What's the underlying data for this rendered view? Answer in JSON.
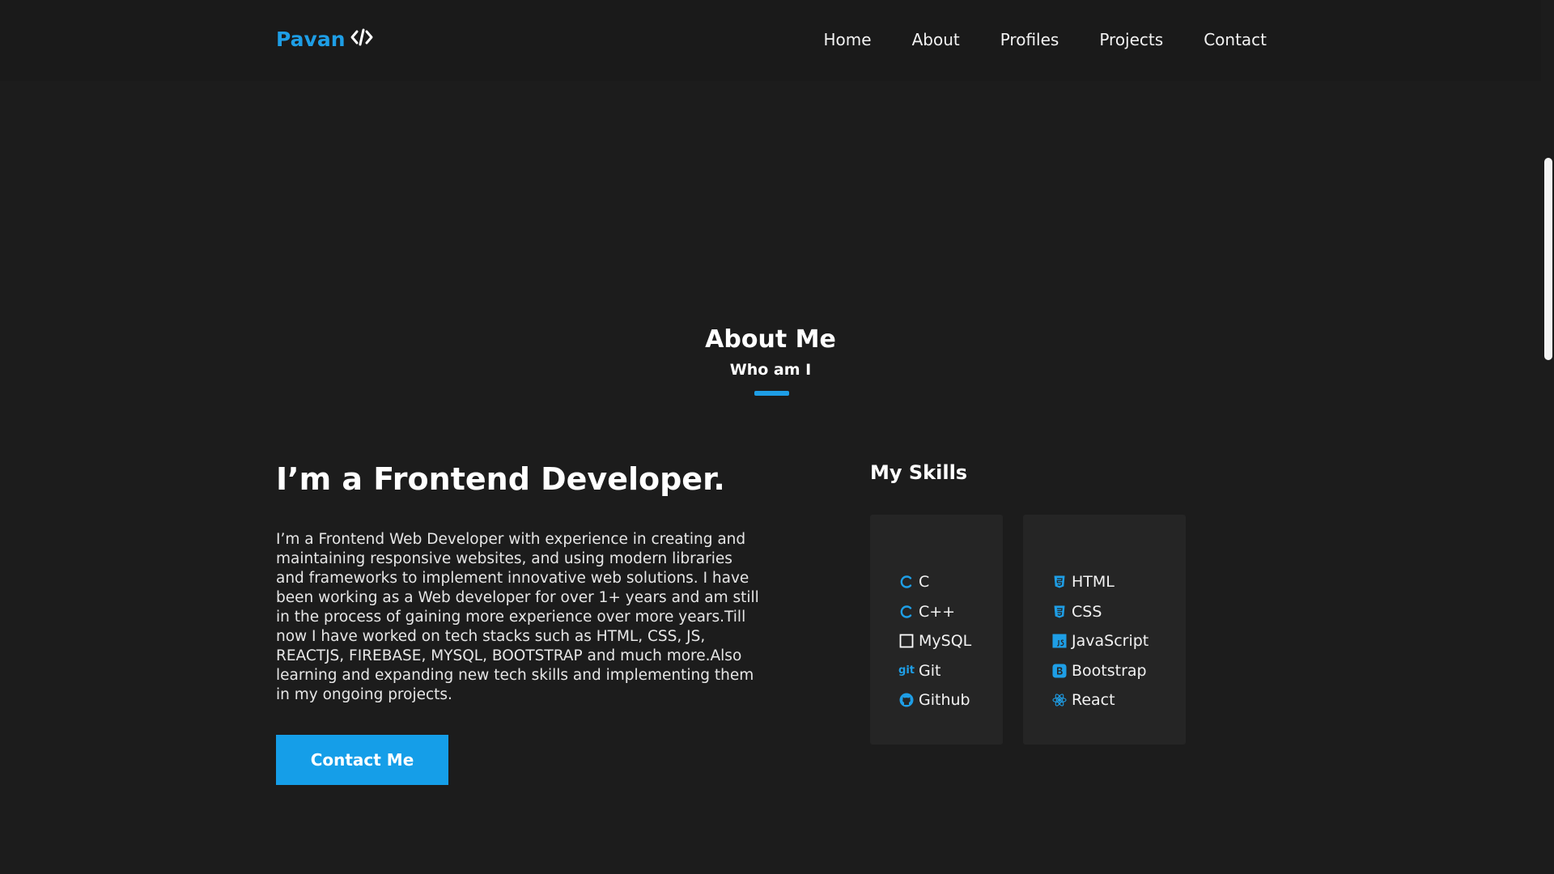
{
  "nav": {
    "logo": "Pavan",
    "links": [
      "Home",
      "About",
      "Profiles",
      "Projects",
      "Contact"
    ]
  },
  "about": {
    "title": "About Me",
    "subtitle": "Who am I",
    "heading": "I’m a Frontend Developer.",
    "description": "I’m a Frontend Web Developer with experience in creating and maintaining responsive websites, and using modern libraries and frameworks to implement innovative web solutions. I have been working as a Web developer for over 1+ years and am still in the process of gaining more experience over more years.Till now I have worked on tech stacks such as HTML, CSS, JS, REACTJS, FIREBASE, MYSQL, BOOTSTRAP and much more.Also learning and expanding new tech skills and implementing them in my ongoing projects.",
    "button": "Contact Me"
  },
  "skills": {
    "title": "My Skills",
    "column1": [
      {
        "label": "C",
        "icon": "c-icon"
      },
      {
        "label": "C++",
        "icon": "cpp-icon"
      },
      {
        "label": "MySQL",
        "icon": "mysql-icon"
      },
      {
        "label": "Git",
        "icon": "git-icon",
        "icon_text": "git"
      },
      {
        "label": "Github",
        "icon": "github-icon"
      }
    ],
    "column2": [
      {
        "label": "HTML",
        "icon": "html5-icon"
      },
      {
        "label": "CSS",
        "icon": "css3-icon"
      },
      {
        "label": "JavaScript",
        "icon": "javascript-icon"
      },
      {
        "label": "Bootstrap",
        "icon": "bootstrap-icon"
      },
      {
        "label": "React",
        "icon": "react-icon"
      }
    ]
  },
  "colors": {
    "accent": "#1e9ee6",
    "background": "#1c1c1c",
    "card": "#252525"
  }
}
